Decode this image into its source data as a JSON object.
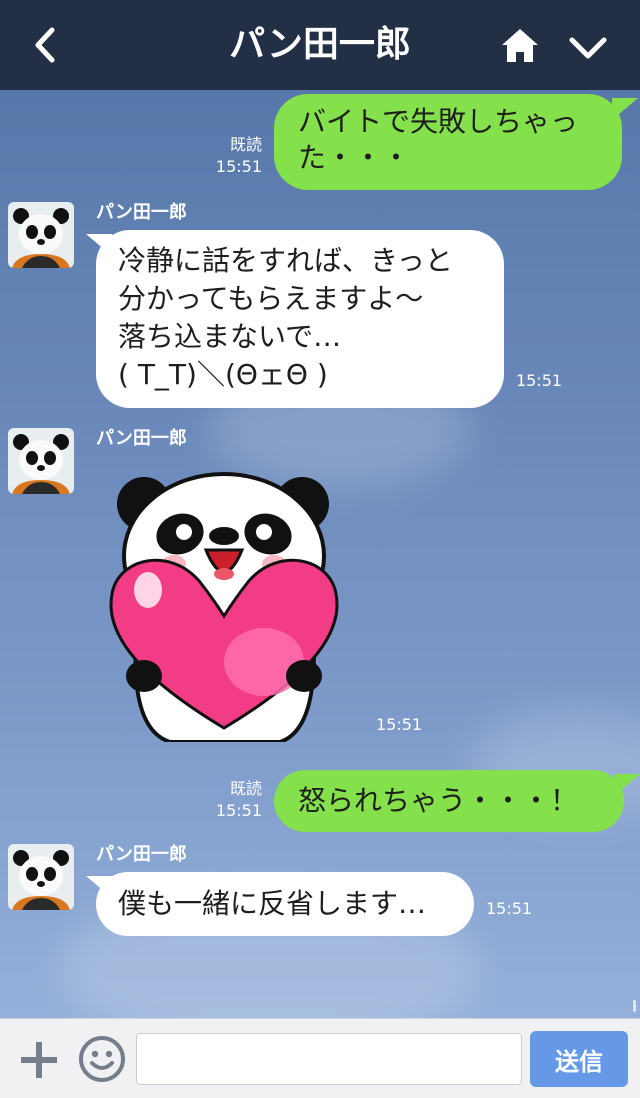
{
  "header": {
    "title": "パン田一郎",
    "back_icon": "chevron-left-icon",
    "home_icon": "home-icon",
    "menu_icon": "chevron-down-icon",
    "background_color": "#232f44"
  },
  "messages": [
    {
      "type": "outgoing",
      "text": "バイトで失敗しちゃった・・・",
      "read": "既読",
      "time": "15:51"
    },
    {
      "type": "incoming",
      "sender": "パン田一郎",
      "lines": [
        "冷静に話をすれば、きっと",
        "分かってもらえますよ〜",
        "落ち込まないで…",
        "( T_T)＼(ΘェΘ )"
      ],
      "time": "15:51"
    },
    {
      "type": "sticker",
      "sender": "パン田一郎",
      "sticker": "panda-holding-heart",
      "time": "15:51"
    },
    {
      "type": "outgoing",
      "text": "怒られちゃう・・・！",
      "read": "既読",
      "time": "15:51"
    },
    {
      "type": "incoming",
      "sender": "パン田一郎",
      "text": "僕も一緒に反省します…",
      "time": "15:51"
    }
  ],
  "footer": {
    "plus_icon": "plus-icon",
    "emoji_icon": "smiley-icon",
    "input_value": "",
    "input_placeholder": "",
    "send_label": "送信"
  },
  "colors": {
    "outgoing_bubble": "#84e14c",
    "incoming_bubble": "#ffffff",
    "send_button": "#6599e8",
    "chat_background": "#6d8dbe"
  }
}
